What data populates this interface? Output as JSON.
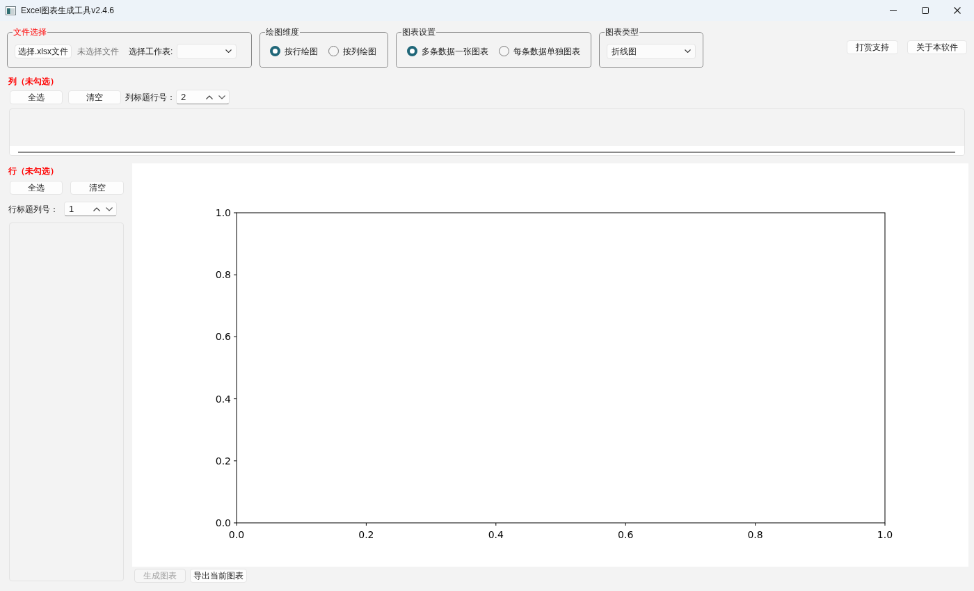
{
  "window": {
    "title": "Excel图表生成工具v2.4.6"
  },
  "file_group": {
    "title": "文件选择",
    "choose_button": "选择.xlsx文件",
    "file_status": "未选择文件",
    "sheet_label": "选择工作表:"
  },
  "dimension_group": {
    "title": "绘图维度",
    "options": [
      {
        "label": "按行绘图",
        "selected": true
      },
      {
        "label": "按列绘图",
        "selected": false
      }
    ]
  },
  "chart_mode_group": {
    "title": "图表设置",
    "options": [
      {
        "label": "多条数据一张图表",
        "selected": true
      },
      {
        "label": "每条数据单独图表",
        "selected": false
      }
    ]
  },
  "chart_type_group": {
    "title": "图表类型",
    "value": "折线图"
  },
  "top_buttons": [
    "打赏支持",
    "关于本软件"
  ],
  "columns_panel": {
    "title": "列（未勾选）",
    "buttons": [
      "全选",
      "清空"
    ],
    "header_label": "列标题行号：",
    "header_value": "2"
  },
  "rows_panel": {
    "title": "行（未勾选）",
    "buttons": [
      "全选",
      "清空"
    ],
    "header_label": "行标题列号：",
    "header_value": "1"
  },
  "chart": {
    "chart_data": {
      "type": "line",
      "xlim": [
        0,
        1
      ],
      "ylim": [
        0,
        1
      ],
      "xticks": [
        {
          "value": 0,
          "label": "0.0"
        },
        {
          "value": 0.2,
          "label": "0.2"
        },
        {
          "value": 0.4,
          "label": "0.4"
        },
        {
          "value": 0.6,
          "label": "0.6"
        },
        {
          "value": 0.8,
          "label": "0.8"
        },
        {
          "value": 1,
          "label": "1.0"
        }
      ],
      "yticks": [
        {
          "value": 0,
          "label": "0.0"
        },
        {
          "value": 0.2,
          "label": "0.2"
        },
        {
          "value": 0.4,
          "label": "0.4"
        },
        {
          "value": 0.6,
          "label": "0.6"
        },
        {
          "value": 0.8,
          "label": "0.8"
        },
        {
          "value": 1,
          "label": "1.0"
        }
      ]
    }
  },
  "bottom_buttons": [
    {
      "label": "生成图表",
      "disabled": true
    },
    {
      "label": "导出当前图表",
      "disabled": false
    }
  ]
}
